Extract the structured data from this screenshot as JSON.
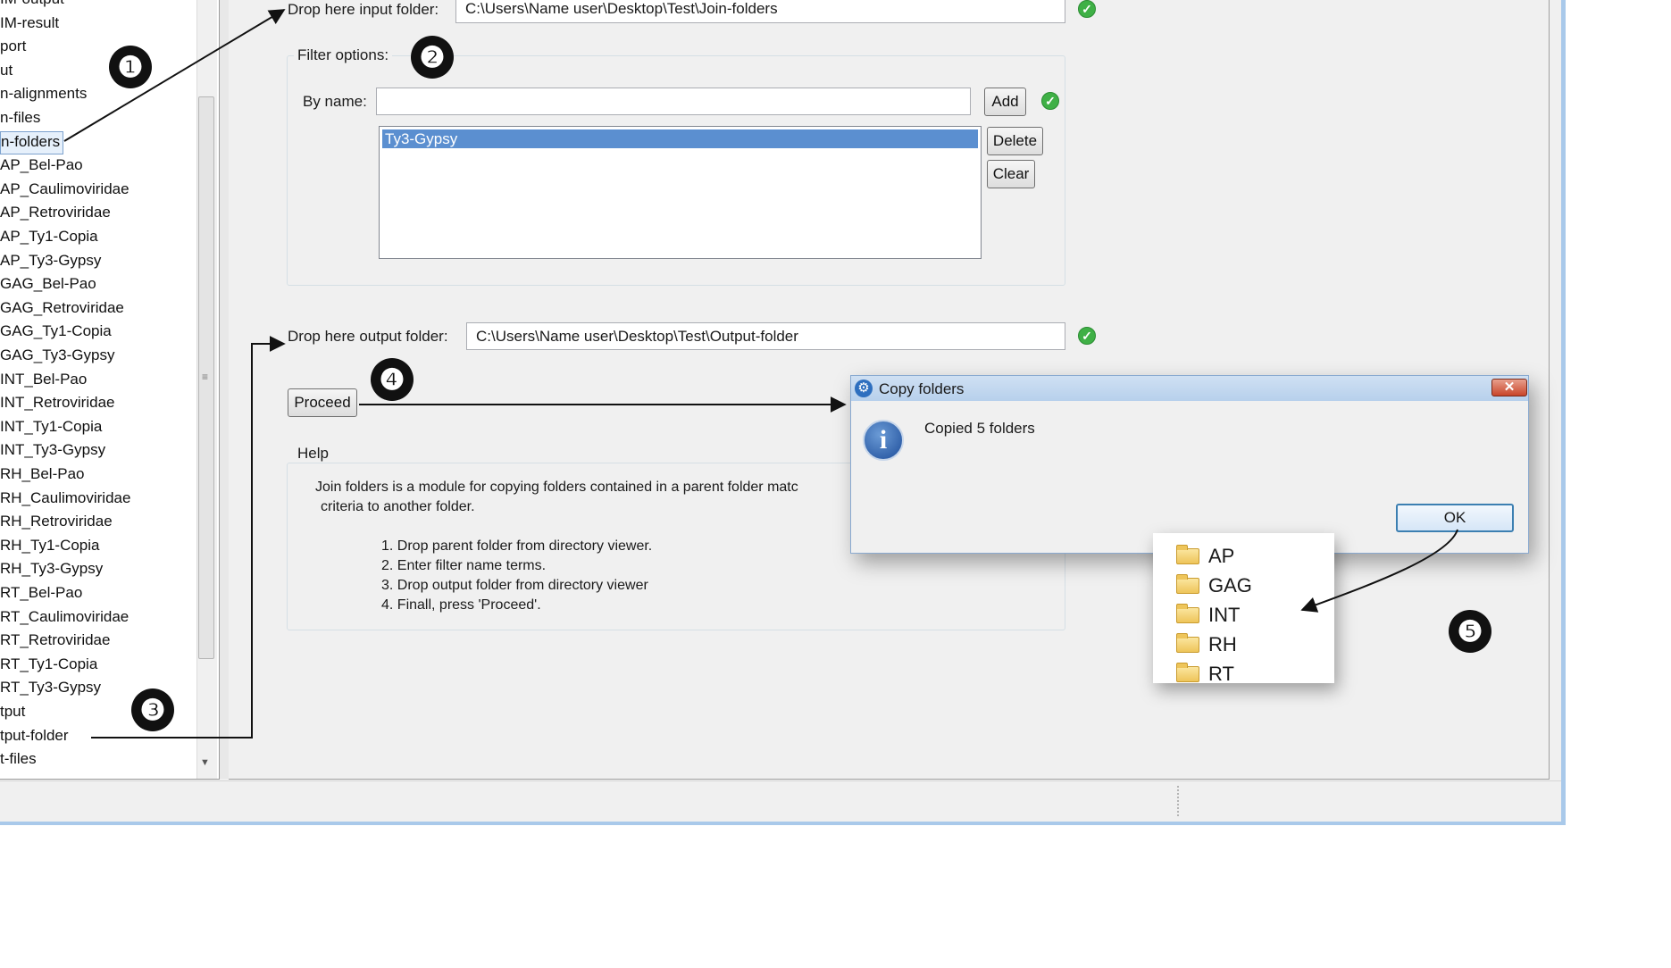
{
  "tree": {
    "items": [
      {
        "label": "IM-output"
      },
      {
        "label": "IM-result"
      },
      {
        "label": "port"
      },
      {
        "label": "ut"
      },
      {
        "label": "n-alignments"
      },
      {
        "label": "n-files"
      },
      {
        "label": "n-folders",
        "selected": true
      },
      {
        "label": "AP_Bel-Pao"
      },
      {
        "label": "AP_Caulimoviridae"
      },
      {
        "label": "AP_Retroviridae"
      },
      {
        "label": "AP_Ty1-Copia"
      },
      {
        "label": "AP_Ty3-Gypsy"
      },
      {
        "label": "GAG_Bel-Pao"
      },
      {
        "label": "GAG_Retroviridae"
      },
      {
        "label": "GAG_Ty1-Copia"
      },
      {
        "label": "GAG_Ty3-Gypsy"
      },
      {
        "label": "INT_Bel-Pao"
      },
      {
        "label": "INT_Retroviridae"
      },
      {
        "label": "INT_Ty1-Copia"
      },
      {
        "label": "INT_Ty3-Gypsy"
      },
      {
        "label": "RH_Bel-Pao"
      },
      {
        "label": "RH_Caulimoviridae"
      },
      {
        "label": "RH_Retroviridae"
      },
      {
        "label": "RH_Ty1-Copia"
      },
      {
        "label": "RH_Ty3-Gypsy"
      },
      {
        "label": "RT_Bel-Pao"
      },
      {
        "label": "RT_Caulimoviridae"
      },
      {
        "label": "RT_Retroviridae"
      },
      {
        "label": "RT_Ty1-Copia"
      },
      {
        "label": "RT_Ty3-Gypsy"
      },
      {
        "label": "tput"
      },
      {
        "label": "tput-folder"
      },
      {
        "label": "t-files"
      }
    ]
  },
  "input": {
    "label": "Drop here input folder:",
    "value": "C:\\Users\\Name user\\Desktop\\Test\\Join-folders"
  },
  "filter": {
    "legend": "Filter options:",
    "by_name_label": "By name:",
    "by_name_value": "",
    "add_label": "Add",
    "delete_label": "Delete",
    "clear_label": "Clear",
    "list": [
      "Ty3-Gypsy"
    ]
  },
  "output": {
    "label": "Drop here output folder:",
    "value": "C:\\Users\\Name user\\Desktop\\Test\\Output-folder"
  },
  "proceed_label": "Proceed",
  "help": {
    "legend": "Help",
    "line1": "Join folders is a module for copying folders contained in a parent folder matc",
    "line2": "criteria to another folder.",
    "steps": [
      "1. Drop parent folder from directory viewer.",
      "2. Enter filter name terms.",
      "3. Drop output folder from directory viewer",
      "4. Finall, press 'Proceed'."
    ]
  },
  "dialog": {
    "title": "Copy folders",
    "close_glyph": "✕",
    "message": "Copied 5 folders",
    "ok_label": "OK",
    "icon": "info-icon"
  },
  "folders": [
    "AP",
    "GAG",
    "INT",
    "RH",
    "RT"
  ],
  "badges": [
    "❶",
    "❷",
    "❸",
    "❹",
    "❺"
  ],
  "colors": {
    "accent": "#5b8fd0",
    "ok_check": "#3fb046",
    "window_border": "#a9c9ea"
  }
}
